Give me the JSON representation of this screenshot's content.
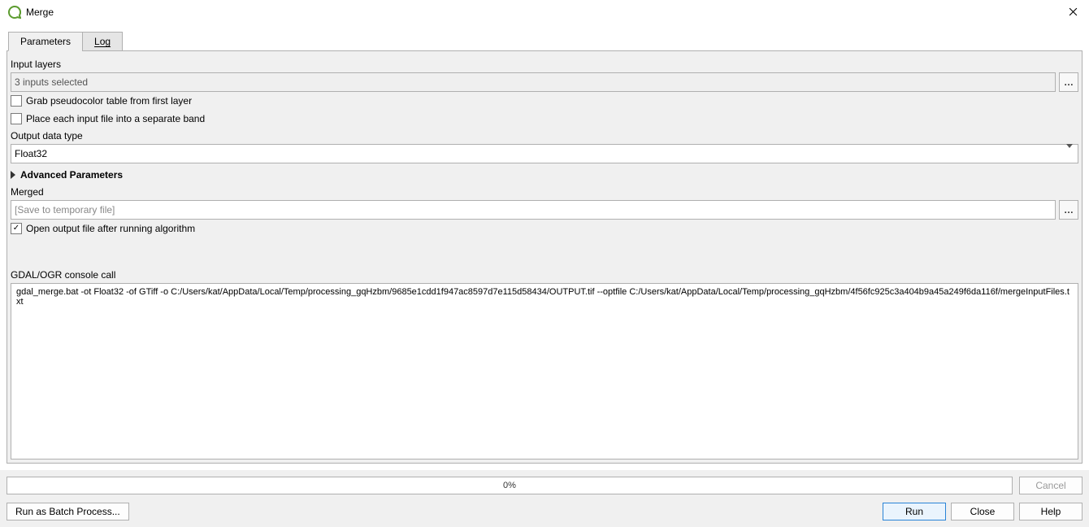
{
  "window": {
    "title": "Merge"
  },
  "tabs": {
    "parameters": "Parameters",
    "log": "Log"
  },
  "labels": {
    "input_layers": "Input layers",
    "output_data_type": "Output data type",
    "advanced": "Advanced Parameters",
    "merged": "Merged",
    "console": "GDAL/OGR console call"
  },
  "fields": {
    "input_layers_value": "3 inputs selected",
    "output_data_type_value": "Float32",
    "merged_placeholder": "[Save to temporary file]"
  },
  "checkboxes": {
    "pseudocolor": "Grab pseudocolor table from first layer",
    "separate_band": "Place each input file into a separate band",
    "open_output": "Open output file after running algorithm"
  },
  "console_call": "gdal_merge.bat -ot Float32 -of GTiff -o C:/Users/kat/AppData/Local/Temp/processing_gqHzbm/9685e1cdd1f947ac8597d7e115d58434/OUTPUT.tif --optfile C:/Users/kat/AppData/Local/Temp/processing_gqHzbm/4f56fc925c3a404b9a45a249f6da116f/mergeInputFiles.txt",
  "progress": {
    "percent": "0%"
  },
  "buttons": {
    "cancel": "Cancel",
    "batch": "Run as Batch Process...",
    "run": "Run",
    "close": "Close",
    "help": "Help",
    "ellipsis": "…"
  }
}
